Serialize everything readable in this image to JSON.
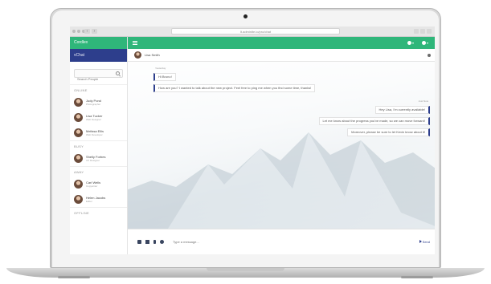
{
  "browser": {
    "url": "lt.adminlte.io/pro/chat"
  },
  "app": {
    "brand": "Cordlex",
    "channel": "vChat"
  },
  "sidebar": {
    "search_placeholder": "Search People",
    "groups": [
      {
        "label": "ONLINE",
        "contacts": [
          {
            "name": "Judy Pond",
            "role": "Photographer"
          },
          {
            "name": "Lisa Tucker",
            "role": "Web Designer"
          },
          {
            "name": "Melissa Ellis",
            "role": "Web Developer"
          }
        ]
      },
      {
        "label": "BUSY",
        "contacts": [
          {
            "name": "Shelly Forbes",
            "role": "UX Designer"
          }
        ]
      },
      {
        "label": "AWAY",
        "contacts": [
          {
            "name": "Carl Wells",
            "role": "Copywriter"
          },
          {
            "name": "Helen Jacobs",
            "role": "Editor"
          }
        ]
      },
      {
        "label": "OFFLINE",
        "contacts": []
      }
    ]
  },
  "chat": {
    "contact_name": "Lisa Smith",
    "messages": [
      {
        "direction": "in",
        "meta": "Yesterday",
        "text": "Hi Bruno!"
      },
      {
        "direction": "in",
        "meta": "",
        "text": "How are you? I wanted to talk about the new project. Feel free to ping me when you find some time, thanks!"
      },
      {
        "direction": "out",
        "meta": "Just Now",
        "text": "Hey Lisa, I'm currently available!"
      },
      {
        "direction": "out",
        "meta": "",
        "text": "Let me know about the progress you've made, so we can move forward!"
      },
      {
        "direction": "out",
        "meta": "",
        "text": "Moreover, please be sure to let Kevin know about it!"
      }
    ]
  },
  "composer": {
    "placeholder": "Type a message...",
    "send_label": "Send"
  },
  "colors": {
    "accent_green": "#2fb67a",
    "accent_navy": "#2d3e8c"
  }
}
